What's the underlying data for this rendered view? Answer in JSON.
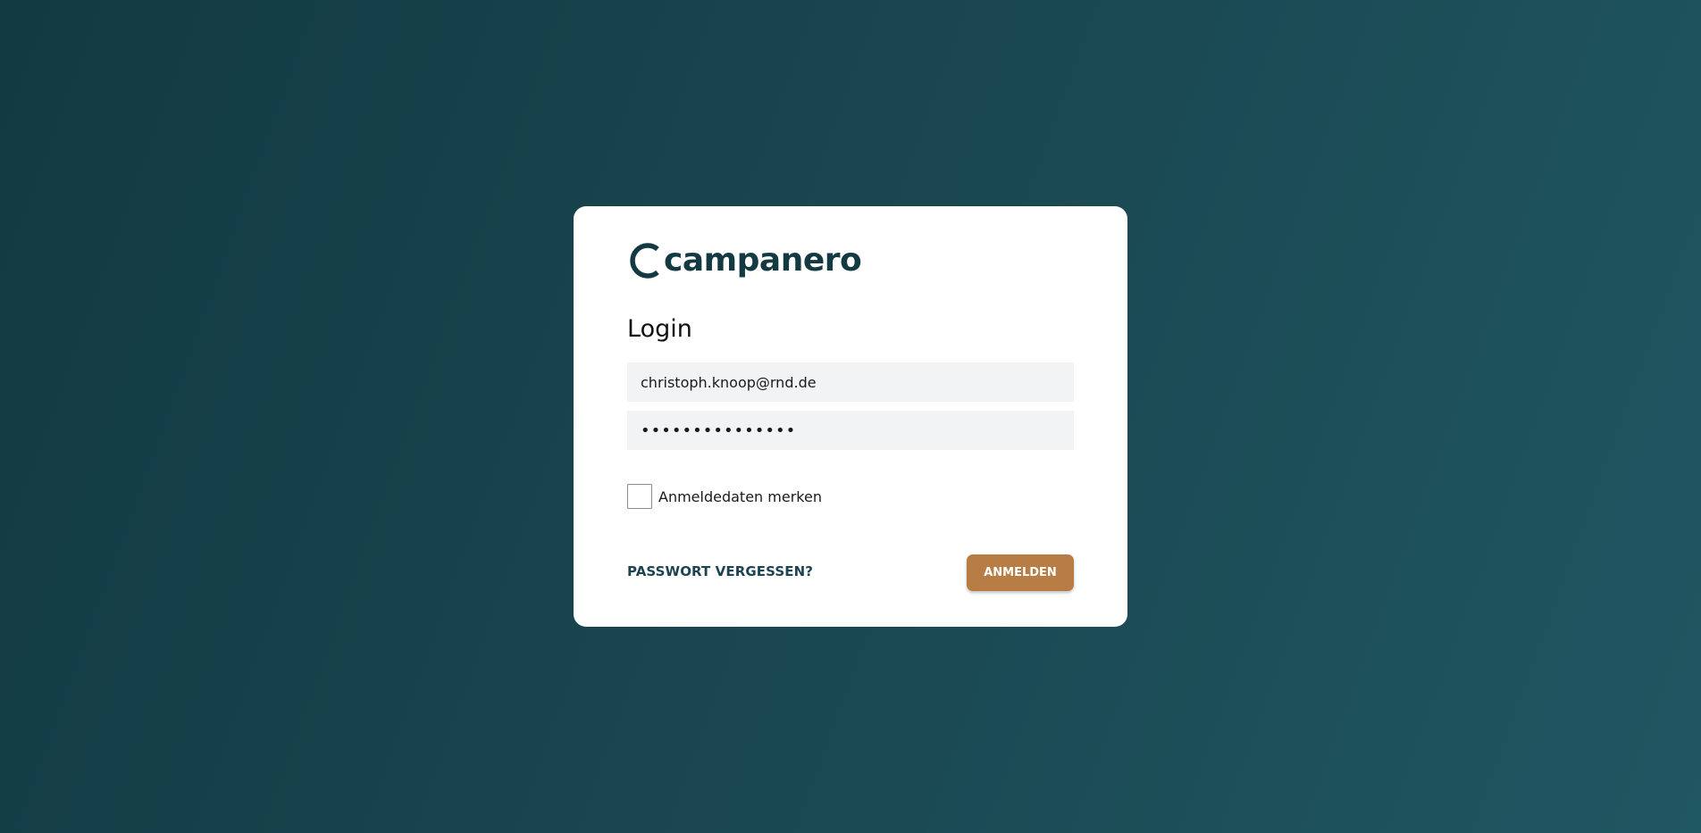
{
  "brand": {
    "name": "campanero",
    "icon": "campanero-c-logo",
    "color": "#133a42"
  },
  "login": {
    "title": "Login",
    "email_value": "christoph.knoop@rnd.de",
    "password_value": "•••••••••••••••",
    "remember_label": "Anmeldedaten merken",
    "remember_checked": false,
    "forgot_label": "PASSWORT VERGESSEN?",
    "submit_label": "ANMELDEN"
  },
  "colors": {
    "background_start": "#123a42",
    "background_end": "#1f5762",
    "accent": "#b87c45",
    "link": "#1d4450",
    "field_background": "#f2f3f4"
  }
}
